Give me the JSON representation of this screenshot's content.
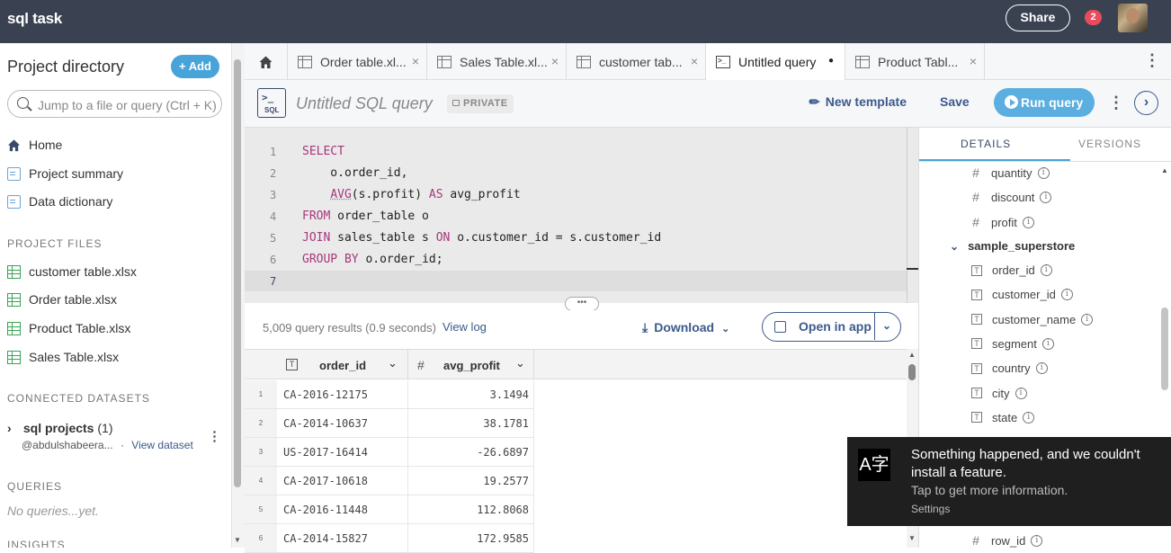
{
  "app": {
    "title": "sql task",
    "share_label": "Share",
    "notification_count": "2"
  },
  "sidebar": {
    "title": "Project directory",
    "add_label": "+ Add",
    "search_placeholder": "Jump to a file or query (Ctrl + K)",
    "nav": [
      {
        "label": "Home",
        "icon": "home-icon"
      },
      {
        "label": "Project summary",
        "icon": "document-icon"
      },
      {
        "label": "Data dictionary",
        "icon": "document-icon"
      }
    ],
    "project_files_heading": "PROJECT FILES",
    "files": [
      {
        "label": "customer table.xlsx"
      },
      {
        "label": "Order table.xlsx"
      },
      {
        "label": "Product Table.xlsx"
      },
      {
        "label": "Sales Table.xlsx"
      }
    ],
    "datasets_heading": "CONNECTED DATASETS",
    "dataset": {
      "name": "sql projects",
      "count": "(1)",
      "owner": "@abdulshabeera...",
      "separator": "·",
      "view_label": "View dataset"
    },
    "queries_heading": "QUERIES",
    "queries_empty": "No queries...yet.",
    "insights_heading": "INSIGHTS"
  },
  "tabs": [
    {
      "label": "Order table.xl...",
      "close": "×"
    },
    {
      "label": "Sales Table.xl...",
      "close": "×"
    },
    {
      "label": "customer tab...",
      "close": "×"
    },
    {
      "label": "Untitled query",
      "close": "●"
    },
    {
      "label": "Product Tabl...",
      "close": "×"
    }
  ],
  "toolbar": {
    "sql_icon_text": "SQL",
    "query_title": "Untitled SQL query",
    "private_label": "PRIVATE",
    "new_template_label": "New template",
    "save_label": "Save",
    "run_label": "Run query"
  },
  "editor": {
    "line_numbers": [
      "1",
      "2",
      "3",
      "4",
      "5",
      "6",
      "7"
    ],
    "lines": [
      {
        "kw": "SELECT",
        "rest": ""
      },
      {
        "kw": "",
        "rest": "    o.order_id,"
      },
      {
        "kw": "",
        "rest": "    AVG(s.profit) AS avg_profit",
        "inner_kw": "AS"
      },
      {
        "kw": "FROM",
        "rest": " order_table o"
      },
      {
        "kw": "JOIN",
        "rest": " sales_table s ON o.customer_id = s.customer_id"
      },
      {
        "kw": "GROUP BY",
        "rest": " o.order_id;"
      },
      {
        "kw": "",
        "rest": ""
      }
    ]
  },
  "results": {
    "count_text": "5,009 query results (0.9 seconds)",
    "view_log_label": "View log",
    "download_label": "Download",
    "open_in_app_label": "Open in app",
    "columns": [
      "order_id",
      "avg_profit"
    ],
    "rows": [
      {
        "n": "1",
        "order_id": "CA-2016-12175",
        "avg_profit": "3.1494"
      },
      {
        "n": "2",
        "order_id": "CA-2014-10637",
        "avg_profit": "38.1781"
      },
      {
        "n": "3",
        "order_id": "US-2017-16414",
        "avg_profit": "-26.6897"
      },
      {
        "n": "4",
        "order_id": "CA-2017-10618",
        "avg_profit": "19.2577"
      },
      {
        "n": "5",
        "order_id": "CA-2016-11448",
        "avg_profit": "112.8068"
      },
      {
        "n": "6",
        "order_id": "CA-2014-15827",
        "avg_profit": "172.9585"
      }
    ]
  },
  "right_panel": {
    "tabs": [
      "DETAILS",
      "VERSIONS"
    ],
    "numeric_fields": [
      "quantity",
      "discount",
      "profit"
    ],
    "group_name": "sample_superstore",
    "text_fields": [
      "order_id",
      "customer_id",
      "customer_name",
      "segment",
      "country",
      "city",
      "state"
    ],
    "bottom_field": "row_id"
  },
  "toast": {
    "message": "Something happened, and we couldn't install a feature.",
    "subtext": "Tap to get more information.",
    "settings_label": "Settings"
  },
  "colors": {
    "topbar": "#3a4252",
    "accent": "#48a3d9",
    "link": "#3b5a8a",
    "keyword": "#a7377a"
  }
}
